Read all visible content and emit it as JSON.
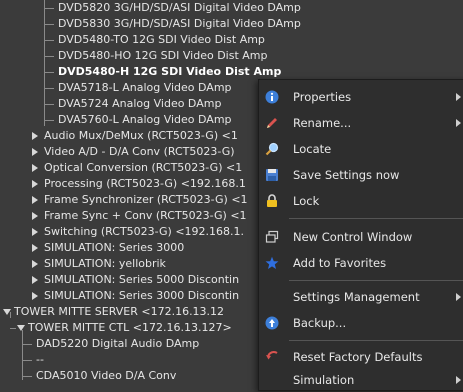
{
  "tree": {
    "items": [
      {
        "label": "DVD5820 3G/HD/SD/ASI Digital Video DAmp"
      },
      {
        "label": "DVD5830 3G/HD/SD/ASI Digital Video DAmp"
      },
      {
        "label": "DVD5480-TO 12G SDI Video Dist Amp"
      },
      {
        "label": "DVD5480-HO 12G SDI Video Dist Amp"
      },
      {
        "label": "DVD5480-H 12G SDI Video Dist Amp"
      },
      {
        "label": "DVA5718-L Analog Video DAmp"
      },
      {
        "label": "DVA5724 Analog Video DAmp"
      },
      {
        "label": "DVA5760-L Analog Video DAmp"
      },
      {
        "label": "Audio Mux/DeMux (RCT5023-G) <1"
      },
      {
        "label": "Video A/D - D/A Conv (RCT5023-G)"
      },
      {
        "label": "Optical Conversion (RCT5023-G) <1"
      },
      {
        "label": "Processing (RCT5023-G) <192.168.1"
      },
      {
        "label": "Frame Synchronizer (RCT5023-G) <1"
      },
      {
        "label": "Frame Sync + Conv (RCT5023-G) <1"
      },
      {
        "label": "Switching (RCT5023-G) <192.168.1."
      },
      {
        "label": "SIMULATION: Series 3000"
      },
      {
        "label": "SIMULATION: yellobrik"
      },
      {
        "label": "SIMULATION: Series 5000 Discontin"
      },
      {
        "label": "SIMULATION: Series 3000 Discontin"
      },
      {
        "label": "TOWER MITTE SERVER <172.16.13.12"
      },
      {
        "label": "TOWER MITTE CTL <172.16.13.127>"
      },
      {
        "label": "DAD5220 Digital Audio DAmp"
      },
      {
        "label": "--"
      },
      {
        "label": "CDA5010 Video D/A Conv"
      }
    ]
  },
  "context_menu": {
    "items": [
      {
        "label": "Properties",
        "icon": "info-icon",
        "submenu": true
      },
      {
        "label": "Rename...",
        "icon": "pencil-icon",
        "submenu": true
      },
      {
        "label": "Locate",
        "icon": "magnifier-icon",
        "submenu": false
      },
      {
        "label": "Save Settings now",
        "icon": "floppy-disk-icon",
        "submenu": false
      },
      {
        "label": "Lock",
        "icon": "padlock-icon",
        "submenu": false
      },
      {
        "label": "New Control Window",
        "icon": "window-icon",
        "submenu": false
      },
      {
        "label": "Add to Favorites",
        "icon": "star-icon",
        "submenu": false
      },
      {
        "label": "Settings Management",
        "icon": "",
        "submenu": true
      },
      {
        "label": "Backup...",
        "icon": "backup-icon",
        "submenu": false
      },
      {
        "label": "Reset Factory Defaults",
        "icon": "reset-icon",
        "submenu": false
      },
      {
        "label": "Simulation",
        "icon": "",
        "submenu": true
      }
    ]
  },
  "colors": {
    "background": "#3b3b3b",
    "menu_background": "#2e2e2e",
    "text": "#e6e6e6",
    "star": "#2f6fe0",
    "lock": "#f0c020"
  }
}
